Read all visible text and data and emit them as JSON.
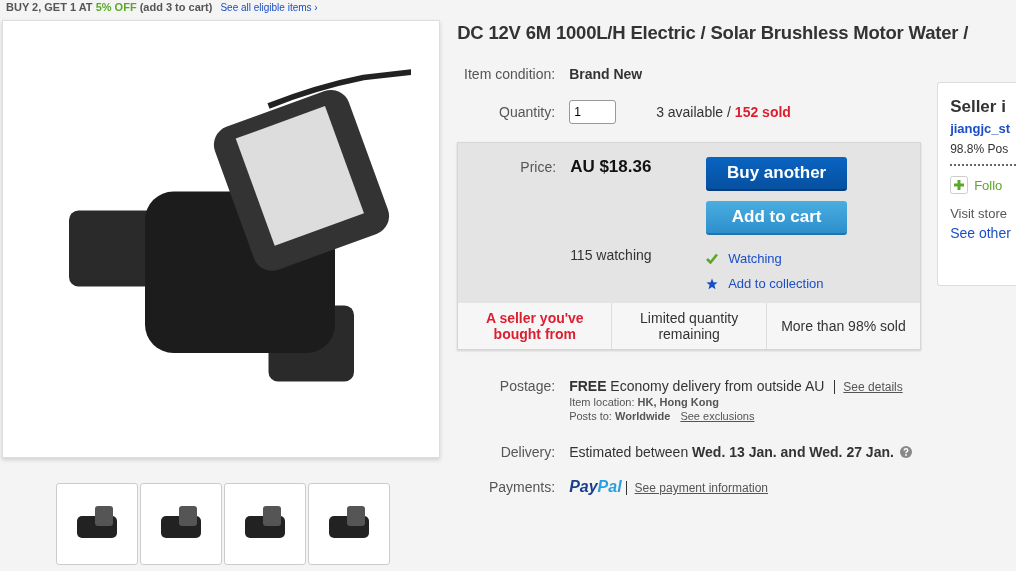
{
  "promo": {
    "text": "BUY 2, GET 1 AT **5% OFF** (add 3 to cart)",
    "link": "See all eligible items ›"
  },
  "title": "DC 12V 6M 1000L/H Electric / Solar Brushless Motor Water /",
  "condition": {
    "label": "Item condition:",
    "value": "Brand New"
  },
  "quantity": {
    "label": "Quantity:",
    "value": "1",
    "available": "3 available /",
    "sold": "152 sold"
  },
  "price_box": {
    "label": "Price:",
    "price": "AU $18.36",
    "watching": "115 watching",
    "buttons": [
      {
        "kind": "primary",
        "label": "Buy another"
      },
      {
        "kind": "secondary",
        "label": "Add to cart"
      }
    ],
    "actions": [
      {
        "kind": "check",
        "label": "Watching"
      },
      {
        "kind": "star",
        "label": "Add to collection"
      }
    ],
    "highlights": [
      {
        "text": "A seller you've bought from",
        "emphasis": true
      },
      {
        "text": "Limited quantity remaining",
        "emphasis": false
      },
      {
        "text": "More than 98% sold",
        "emphasis": false
      }
    ]
  },
  "postage": {
    "label": "Postage:",
    "text": "**FREE**  Economy delivery from outside AU",
    "link": "See details",
    "location": "Item location:  **HK, Hong Kong**",
    "posts_to": "Posts to:  **Worldwide**",
    "exclusions": "See exclusions"
  },
  "delivery": {
    "label": "Delivery:",
    "text": "Estimated between **Wed. 13 Jan. and Wed. 27 Jan.**"
  },
  "payments": {
    "label": "Payments:",
    "brand": [
      "Pay",
      "Pal"
    ],
    "link": "See payment information"
  },
  "seller": {
    "title": "Seller i",
    "name": "jiangjc_st",
    "feedback": "98.8% Pos",
    "follow": "Follo",
    "visit": "Visit store",
    "see_other": "See other"
  }
}
